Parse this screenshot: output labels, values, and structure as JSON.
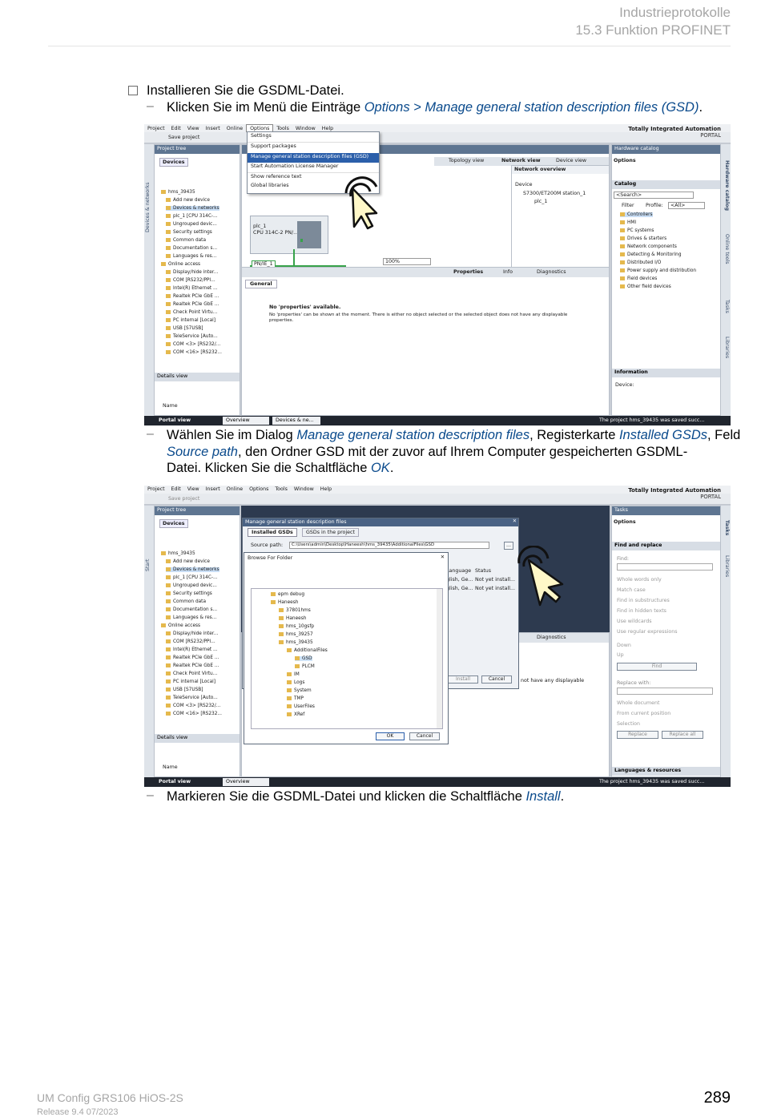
{
  "header": {
    "chapter": "Industrieprotokolle",
    "section": "15.3 Funktion PROFINET"
  },
  "body": {
    "step1": "Installieren Sie die GSDML-Datei.",
    "sub1_pre": "Klicken Sie im Menü die Einträge ",
    "sub1_em": "Options > Manage general station description files (GSD)",
    "sub1_post": ".",
    "sub2_a": "Wählen Sie im Dialog ",
    "sub2_em1": "Manage general station description files",
    "sub2_b": ", Registerkarte ",
    "sub2_em2": "Installed GSDs",
    "sub2_c": ", Feld",
    "sub2_em3": "Source path",
    "sub2_d": ", den Ordner GSD mit der zuvor auf Ihrem Computer gespeicherten GSDML-",
    "sub2_e": "Datei. Klicken Sie die Schaltfläche ",
    "sub2_em4": "OK",
    "sub2_f": ".",
    "sub3_pre": "Markieren Sie die GSDML-Datei und klicken die Schaltfläche ",
    "sub3_em": "Install",
    "sub3_post": "."
  },
  "screenshot1": {
    "menu": [
      "Project",
      "Edit",
      "View",
      "Insert",
      "Online",
      "Options",
      "Tools",
      "Window",
      "Help"
    ],
    "save_project": "Save project",
    "brand_line1": "Totally Integrated Automation",
    "brand_line2": "PORTAL",
    "options_menu": [
      "Settings",
      "Support packages",
      "Manage general station description files (GSD)",
      "Start Automation License Manager",
      "Show reference text",
      "Global libraries"
    ],
    "project_tree_title": "Project tree",
    "devices_tab": "Devices",
    "tree_items": [
      "hms_39435",
      "Add new device",
      "Devices & networks",
      "plc_1 [CPU 314C-...",
      "Ungrouped devic...",
      "Security settings",
      "Common data",
      "Documentation s...",
      "Languages & res...",
      "Online access",
      "Display/hide inter...",
      "COM [RS232/PPI...",
      "Intel(R) Ethernet ...",
      "Realtek PCIe GbE ...",
      "Realtek PCIe GbE ...",
      "Check Point Virtu...",
      "PC internal [Local]",
      "USB [S7USB]",
      "TeleService [Auto...",
      "COM <3> [RS232/...",
      "COM <16> [RS232..."
    ],
    "details_view": "Details view",
    "name_col": "Name",
    "view_tabs": [
      "Topology view",
      "Network view",
      "Device view"
    ],
    "network_overview": "Network overview",
    "device_col": "Device",
    "station": "S7300/ET200M station_1",
    "plc": "plc_1",
    "plc_card_line1": "plc_1",
    "plc_card_line2": "CPU 314C-2 PN/...",
    "pnie": "PN/IE_1",
    "zoom": "100%",
    "properties": "Properties",
    "info": "Info",
    "diagnostics": "Diagnostics",
    "general": "General",
    "no_props": "No 'properties' available.",
    "no_props_desc": "No 'properties' can be shown at the moment. There is either no object selected or the selected object does not have any displayable properties.",
    "catalog_title": "Hardware catalog",
    "options": "Options",
    "catalog": "Catalog",
    "search": "<Search>",
    "filter": "Filter",
    "profile": "Profile:",
    "profile_val": "<All>",
    "catalog_items": [
      "Controllers",
      "HMI",
      "PC systems",
      "Drives & starters",
      "Network components",
      "Detecting & Monitoring",
      "Distributed I/O",
      "Power supply and distribution",
      "Field devices",
      "Other field devices"
    ],
    "information": "Information",
    "device_label": "Device:",
    "side_tabs": [
      "Hardware catalog",
      "Online tools",
      "Tasks",
      "Libraries"
    ],
    "left_side_tab": "Devices & networks",
    "portal_view": "Portal view",
    "overview": "Overview",
    "devices_ne": "Devices & ne...",
    "status_msg": "The project hms_39435 was saved succ..."
  },
  "screenshot2": {
    "dialog_title": "Manage general station description files",
    "tab_installed": "Installed GSDs",
    "tab_project": "GSDs in the project",
    "source_path_label": "Source path:",
    "source_path": "C:\\Users\\admin\\Desktop\\Haneesh\\hms_39435\\AdditionalFiles\\GSD",
    "col_language": "Language",
    "col_status": "Status",
    "row_lang": "glish, Ge...",
    "row_status": "Not yet install...",
    "install": "Install",
    "cancel": "Cancel",
    "browse_title": "Browse For Folder",
    "folders": [
      "epm debug",
      "Haneesh",
      "37801hms",
      "Haneesh",
      "hms_10gsfp",
      "hms_39257",
      "hms_39435",
      "AdditionalFiles",
      "GSD",
      "PLCM",
      "IM",
      "Logs",
      "System",
      "TMP",
      "UserFiles",
      "XRef"
    ],
    "ok": "OK",
    "not_displayable": "not have any displayable",
    "tasks_title": "Tasks",
    "options": "Options",
    "find_replace": "Find and replace",
    "find": "Find:",
    "checks": [
      "Whole words only",
      "Match case",
      "Find in substructures",
      "Find in hidden texts",
      "Use wildcards",
      "Use regular expressions"
    ],
    "down": "Down",
    "up": "Up",
    "find_btn": "Find",
    "replace_with": "Replace with:",
    "radios": [
      "Whole document",
      "From current position",
      "Selection"
    ],
    "replace": "Replace",
    "replace_all": "Replace all",
    "languages_resources": "Languages & resources",
    "diagnostics": "Diagnostics",
    "start_tab": "Start",
    "side_tabs": [
      "Tasks",
      "Libraries"
    ]
  },
  "footer": {
    "doc": "UM Config  GRS106  HiOS-2S",
    "release": "Release  9.4  07/2023",
    "page": "289"
  }
}
